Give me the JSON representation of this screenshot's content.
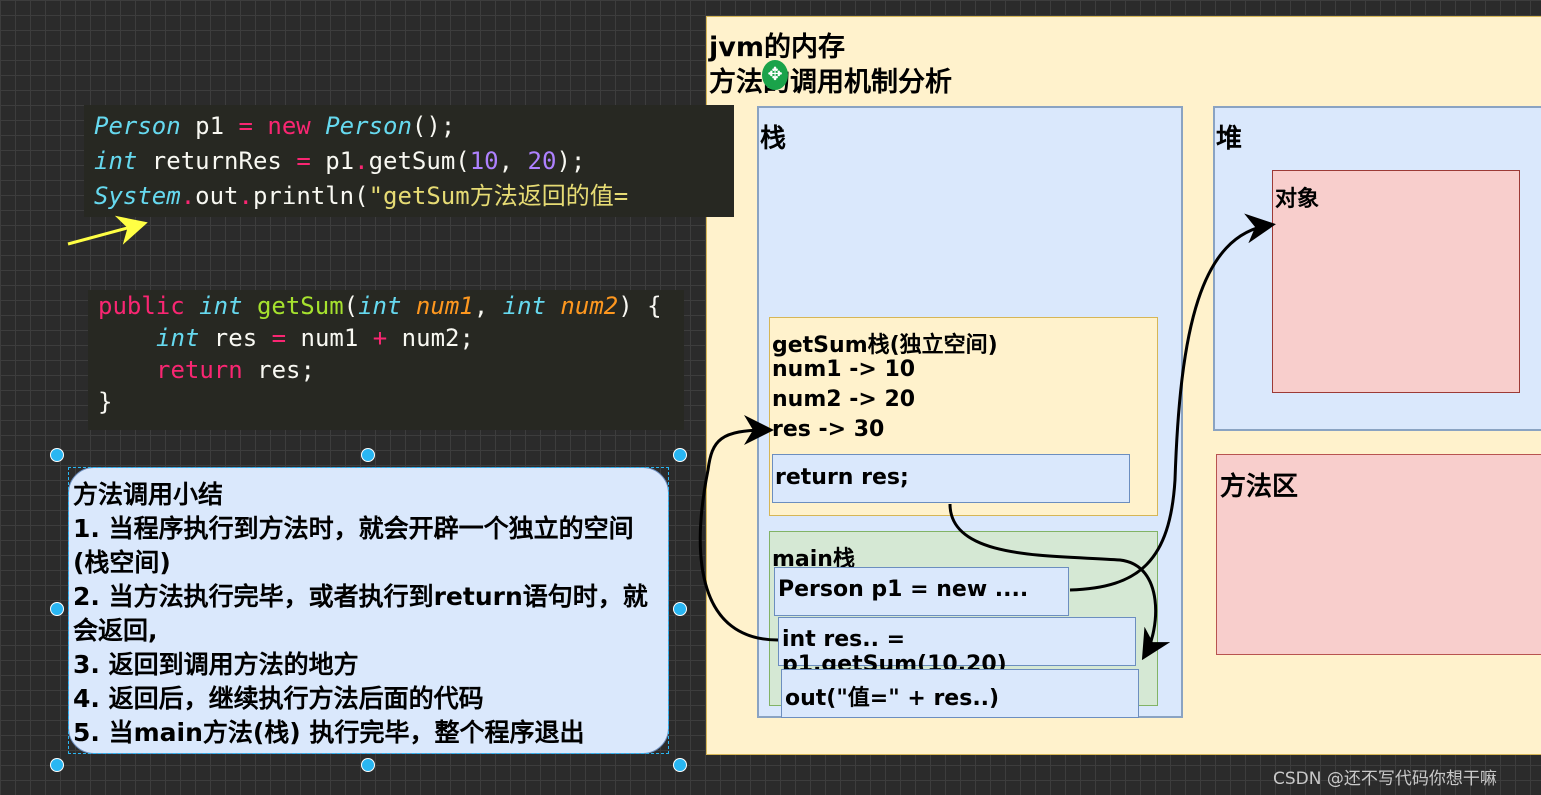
{
  "code_main": {
    "line1": [
      "Person",
      " p1 ",
      "=",
      " new ",
      "Person",
      "();"
    ],
    "line2": [
      "int",
      " returnRes ",
      "=",
      " p1",
      ".",
      "getSum(",
      "10",
      ", ",
      "20",
      ");"
    ],
    "line3": [
      "System",
      ".",
      "out",
      ".",
      "println(",
      "\"getSum方法返回的值="
    ]
  },
  "code_getsum": {
    "line1": [
      "public",
      " int ",
      "getSum",
      "(",
      "int",
      " num1",
      ", ",
      "int",
      " num2",
      ") {"
    ],
    "line2": [
      "int",
      " res ",
      "=",
      " num1 ",
      "+",
      " num2;"
    ],
    "line3": [
      "return",
      " res;"
    ],
    "line4": "}"
  },
  "summary": {
    "title": "方法调用小结",
    "items": [
      "1. 当程序执行到方法时，就会开辟一个独立的空间(栈空间)",
      "2. 当方法执行完毕，或者执行到return语句时，就会返回,",
      "3. 返回到调用方法的地方",
      "4. 返回后，继续执行方法后面的代码",
      "5. 当main方法(栈) 执行完毕，整个程序退出"
    ]
  },
  "jvm": {
    "title1": "jvm的内存",
    "title2": "方法的调用机制分析",
    "stack": "栈",
    "heap": "堆",
    "object": "对象",
    "method_area": "方法区",
    "getsum_frame": {
      "title": "getSum栈(独立空间)",
      "vars": [
        "num1 -> 10",
        "num2 -> 20",
        "res -> 30"
      ],
      "return": "return res;"
    },
    "main_frame": {
      "title": "main栈",
      "rows": [
        "Person p1 = new ....",
        "int res.. = p1.getSum(10,20)",
        "out(\"值=\" + res..)"
      ]
    }
  },
  "watermark": "CSDN @还不写代码你想干嘛",
  "colors": {
    "jvm_bg": "#fff2cc",
    "stack_bg": "#dae8fc",
    "main_bg": "#d5e8d4",
    "object_bg": "#f8cecc"
  }
}
